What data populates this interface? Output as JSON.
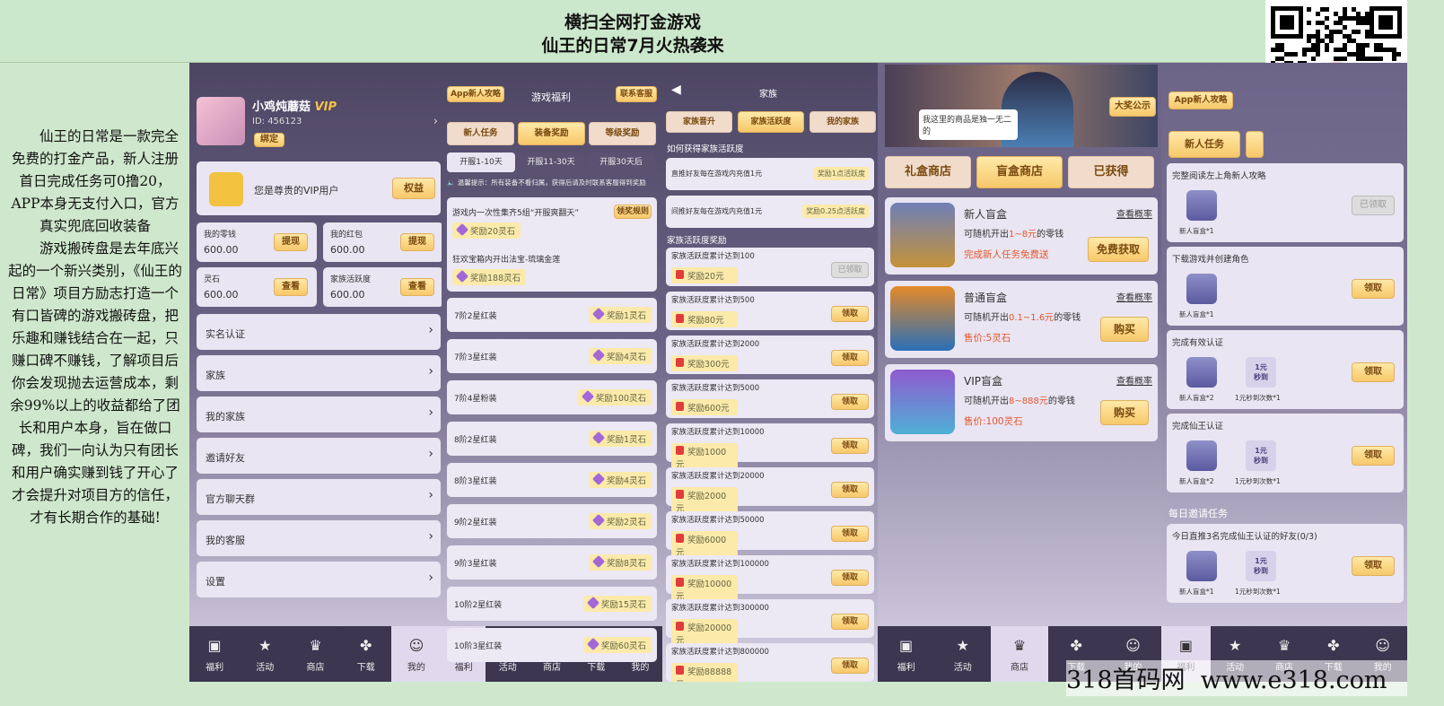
{
  "header": {
    "title1": "横扫全网打金游戏",
    "title2": "仙王的日常7月火热袭来"
  },
  "intro": {
    "p1": "仙王的日常是一款完全免费的打金产品，新人注册首日完成任务可0撸20，APP本身无支付入口，官方真实兜底回收装备",
    "p2": "游戏搬砖盘是去年底兴起的一个新兴类别，《仙王的日常》项目方励志打造一个有口皆碑的游戏搬砖盘，把乐趣和赚钱结合在一起，只赚口碑不赚钱，了解项目后你会发现抛去运营成本，剩余99%以上的收益都给了团长和用户本身，旨在做口碑，我们一向认为只有团长和用户确实赚到钱了开心了才会提升对项目方的信任，才有长期合作的基础!"
  },
  "p1": {
    "name": "小鸡炖蘑菇",
    "vip": "VIP",
    "id": "ID: 456123",
    "bind": "绑定",
    "vipText": "您是尊贵的VIP用户",
    "rights": "权益",
    "stats": [
      {
        "label": "我的零钱",
        "value": "600.00",
        "btn": "提现"
      },
      {
        "label": "我的红包",
        "value": "600.00",
        "btn": "提现"
      },
      {
        "label": "灵石",
        "value": "600.00",
        "btn": "查看"
      },
      {
        "label": "家族活跃度",
        "value": "600.00",
        "btn": "查看"
      }
    ],
    "menu": [
      "实名认证",
      "家族",
      "我的家族",
      "邀请好友",
      "官方聊天群",
      "我的客服",
      "设置"
    ]
  },
  "tabs": [
    "福利",
    "活动",
    "商店",
    "下载",
    "我的"
  ],
  "p2": {
    "guide": "App新人攻略",
    "title": "游戏福利",
    "service": "联系客服",
    "tabs": [
      "新人任务",
      "装备奖励",
      "等级奖励"
    ],
    "subtabs": [
      "开服1-10天",
      "开服11-30天",
      "开服30天后"
    ],
    "tip": "温馨提示：所有装备不看归属，获得后请及时联系客服得到奖励",
    "box1": "游戏内一次性集齐5组“开服爽翻天”",
    "box1btn": "领奖规则",
    "box1rew": "奖励20灵石",
    "box2": "狂欢宝箱内开出法宝-琉璃金莲",
    "box2rew": "奖励188灵石",
    "items": [
      {
        "n": "7阶2星红装",
        "r": "奖励1灵石"
      },
      {
        "n": "7阶3星红装",
        "r": "奖励4灵石"
      },
      {
        "n": "7阶4星粉装",
        "r": "奖励100灵石"
      },
      {
        "n": "8阶2星红装",
        "r": "奖励1灵石"
      },
      {
        "n": "8阶3星红装",
        "r": "奖励4灵石"
      },
      {
        "n": "9阶2星红装",
        "r": "奖励2灵石"
      },
      {
        "n": "9阶3星红装",
        "r": "奖励8灵石"
      },
      {
        "n": "10阶2星红装",
        "r": "奖励15灵石"
      },
      {
        "n": "10阶3星红装",
        "r": "奖励60灵石"
      }
    ]
  },
  "p3": {
    "title": "家族",
    "tabs": [
      "家族晋升",
      "家族活跃度",
      "我的家族"
    ],
    "how": "如何获得家族活跃度",
    "ways": [
      {
        "t": "直推好友每在游戏内充值1元",
        "r": "奖励1点活跃度"
      },
      {
        "t": "间推好友每在游戏内充值1元",
        "r": "奖励0.25点活跃度"
      }
    ],
    "rewardTitle": "家族活跃度奖励",
    "rows": [
      {
        "t": "家族活跃度累计达到100",
        "r": "奖励20元",
        "b": "已领取"
      },
      {
        "t": "家族活跃度累计达到500",
        "r": "奖励80元",
        "b": "领取"
      },
      {
        "t": "家族活跃度累计达到2000",
        "r": "奖励300元",
        "b": "领取"
      },
      {
        "t": "家族活跃度累计达到5000",
        "r": "奖励600元",
        "b": "领取"
      },
      {
        "t": "家族活跃度累计达到10000",
        "r": "奖励1000元",
        "b": "领取"
      },
      {
        "t": "家族活跃度累计达到20000",
        "r": "奖励2000元",
        "b": "领取"
      },
      {
        "t": "家族活跃度累计达到50000",
        "r": "奖励6000元",
        "b": "领取"
      },
      {
        "t": "家族活跃度累计达到100000",
        "r": "奖励10000元",
        "b": "领取"
      },
      {
        "t": "家族活跃度累计达到300000",
        "r": "奖励20000元",
        "b": "领取"
      },
      {
        "t": "家族活跃度累计达到800000",
        "r": "奖励88888元",
        "b": "领取"
      }
    ]
  },
  "p4": {
    "bubble": "我这里的商品是独一无二的",
    "prize": "大奖公示",
    "tabs": [
      "礼盒商店",
      "盲盒商店",
      "已获得"
    ],
    "prob": "查看概率",
    "boxes": [
      {
        "name": "新人盲盒",
        "desc1": "可随机开出",
        "range": "1~8元",
        "desc2": "的零钱",
        "price": "完成新人任务免费送",
        "btn": "免费获取"
      },
      {
        "name": "普通盲盒",
        "desc1": "可随机开出",
        "range": "0.1~1.6元",
        "desc2": "的零钱",
        "price": "售价:5灵石",
        "btn": "购买"
      },
      {
        "name": "VIP盲盒",
        "desc1": "可随机开出",
        "range": "8~888元",
        "desc2": "的零钱",
        "price": "售价:100灵石",
        "btn": "购买"
      }
    ]
  },
  "p5": {
    "guide": "App新人攻略",
    "tab": "新人任务",
    "tasks": [
      {
        "t": "完整阅读左上角新人攻略",
        "a": "新人盲盒*1",
        "b": "已领取",
        "extra": false
      },
      {
        "t": "下载游戏并创建角色",
        "a": "新人盲盒*1",
        "b": "领取",
        "extra": false
      },
      {
        "t": "完成有效认证",
        "a": "新人盲盒*2",
        "b": "领取",
        "extra": true,
        "e1": "1元",
        "e2": "秒到",
        "e3": "1元秒到次数*1"
      },
      {
        "t": "完成仙王认证",
        "a": "新人盲盒*2",
        "b": "领取",
        "extra": true,
        "e1": "1元",
        "e2": "秒到",
        "e3": "1元秒到次数*1"
      }
    ],
    "daily": "每日邀请任务",
    "dtask": {
      "t": "今日直推3名完成仙王认证的好友(0/3)",
      "a": "新人盲盒*1",
      "b": "领取",
      "e1": "1元",
      "e2": "秒到",
      "e3": "1元秒到次数*1"
    }
  },
  "watermark": {
    "cn": "318首码网",
    "url": "www.e318.com"
  }
}
